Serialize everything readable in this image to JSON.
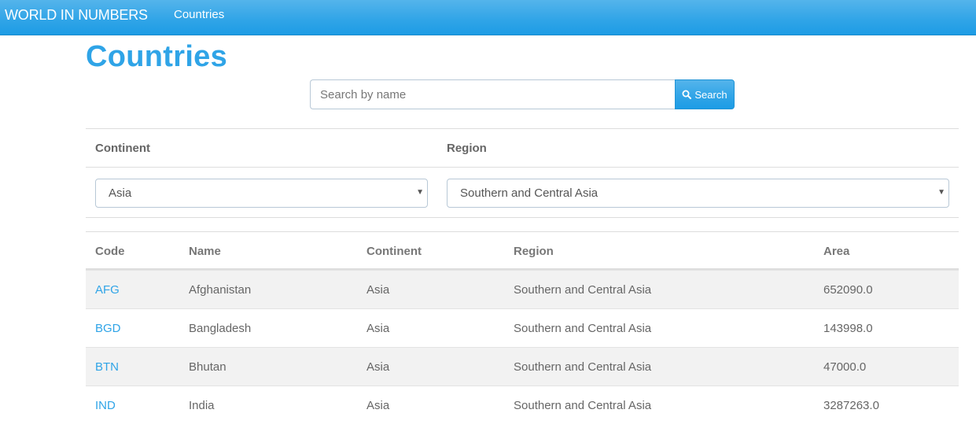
{
  "navbar": {
    "brand": "WORLD IN NUMBERS",
    "link": "Countries"
  },
  "page_title": "Countries",
  "search": {
    "placeholder": "Search by name",
    "value": "",
    "button_label": "Search",
    "button_icon": "search-icon"
  },
  "filters": {
    "continent_label": "Continent",
    "region_label": "Region",
    "continent_value": "Asia",
    "region_value": "Southern and Central Asia"
  },
  "table": {
    "headers": [
      "Code",
      "Name",
      "Continent",
      "Region",
      "Area"
    ],
    "rows": [
      {
        "code": "AFG",
        "name": "Afghanistan",
        "continent": "Asia",
        "region": "Southern and Central Asia",
        "area": "652090.0"
      },
      {
        "code": "BGD",
        "name": "Bangladesh",
        "continent": "Asia",
        "region": "Southern and Central Asia",
        "area": "143998.0"
      },
      {
        "code": "BTN",
        "name": "Bhutan",
        "continent": "Asia",
        "region": "Southern and Central Asia",
        "area": "47000.0"
      },
      {
        "code": "IND",
        "name": "India",
        "continent": "Asia",
        "region": "Southern and Central Asia",
        "area": "3287263.0"
      }
    ]
  },
  "colors": {
    "brand_blue": "#2fa4e7",
    "stripe": "#f2f2f2"
  }
}
